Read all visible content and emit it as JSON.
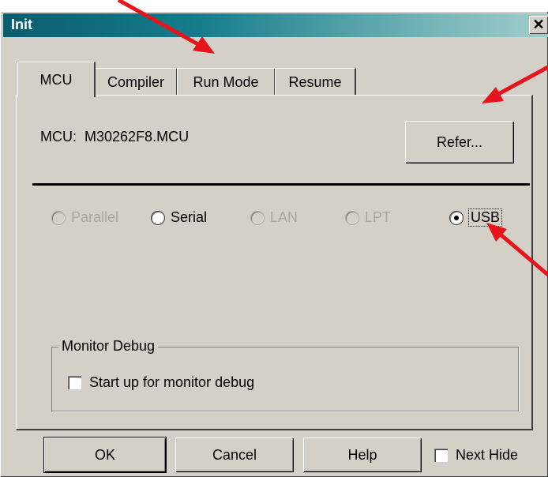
{
  "window": {
    "title": "Init",
    "close_glyph": "✕"
  },
  "tabs": [
    {
      "label": "MCU",
      "active": true
    },
    {
      "label": "Compiler",
      "active": false
    },
    {
      "label": "Run Mode",
      "active": false
    },
    {
      "label": "Resume",
      "active": false
    }
  ],
  "mcu": {
    "label": "MCU:",
    "value": "M30262F8.MCU",
    "refer_button": "Refer..."
  },
  "connection": {
    "options": [
      {
        "label": "Parallel",
        "enabled": false,
        "checked": false
      },
      {
        "label": "Serial",
        "enabled": true,
        "checked": false
      },
      {
        "label": "LAN",
        "enabled": false,
        "checked": false
      },
      {
        "label": "LPT",
        "enabled": false,
        "checked": false
      },
      {
        "label": "USB",
        "enabled": true,
        "checked": true
      }
    ]
  },
  "monitor_debug": {
    "group_label": "Monitor Debug",
    "checkbox_label": "Start up for monitor debug",
    "checked": false
  },
  "footer": {
    "ok": "OK",
    "cancel": "Cancel",
    "help": "Help",
    "next_hide": "Next Hide",
    "next_hide_checked": false
  },
  "annotations": {
    "arrow_color": "#e8141b"
  },
  "colors": {
    "face": "#d4d0c8",
    "title_gradient_start": "#0a5d6e",
    "title_gradient_end": "#a6cfcf",
    "disabled_text": "#a9a79f"
  }
}
